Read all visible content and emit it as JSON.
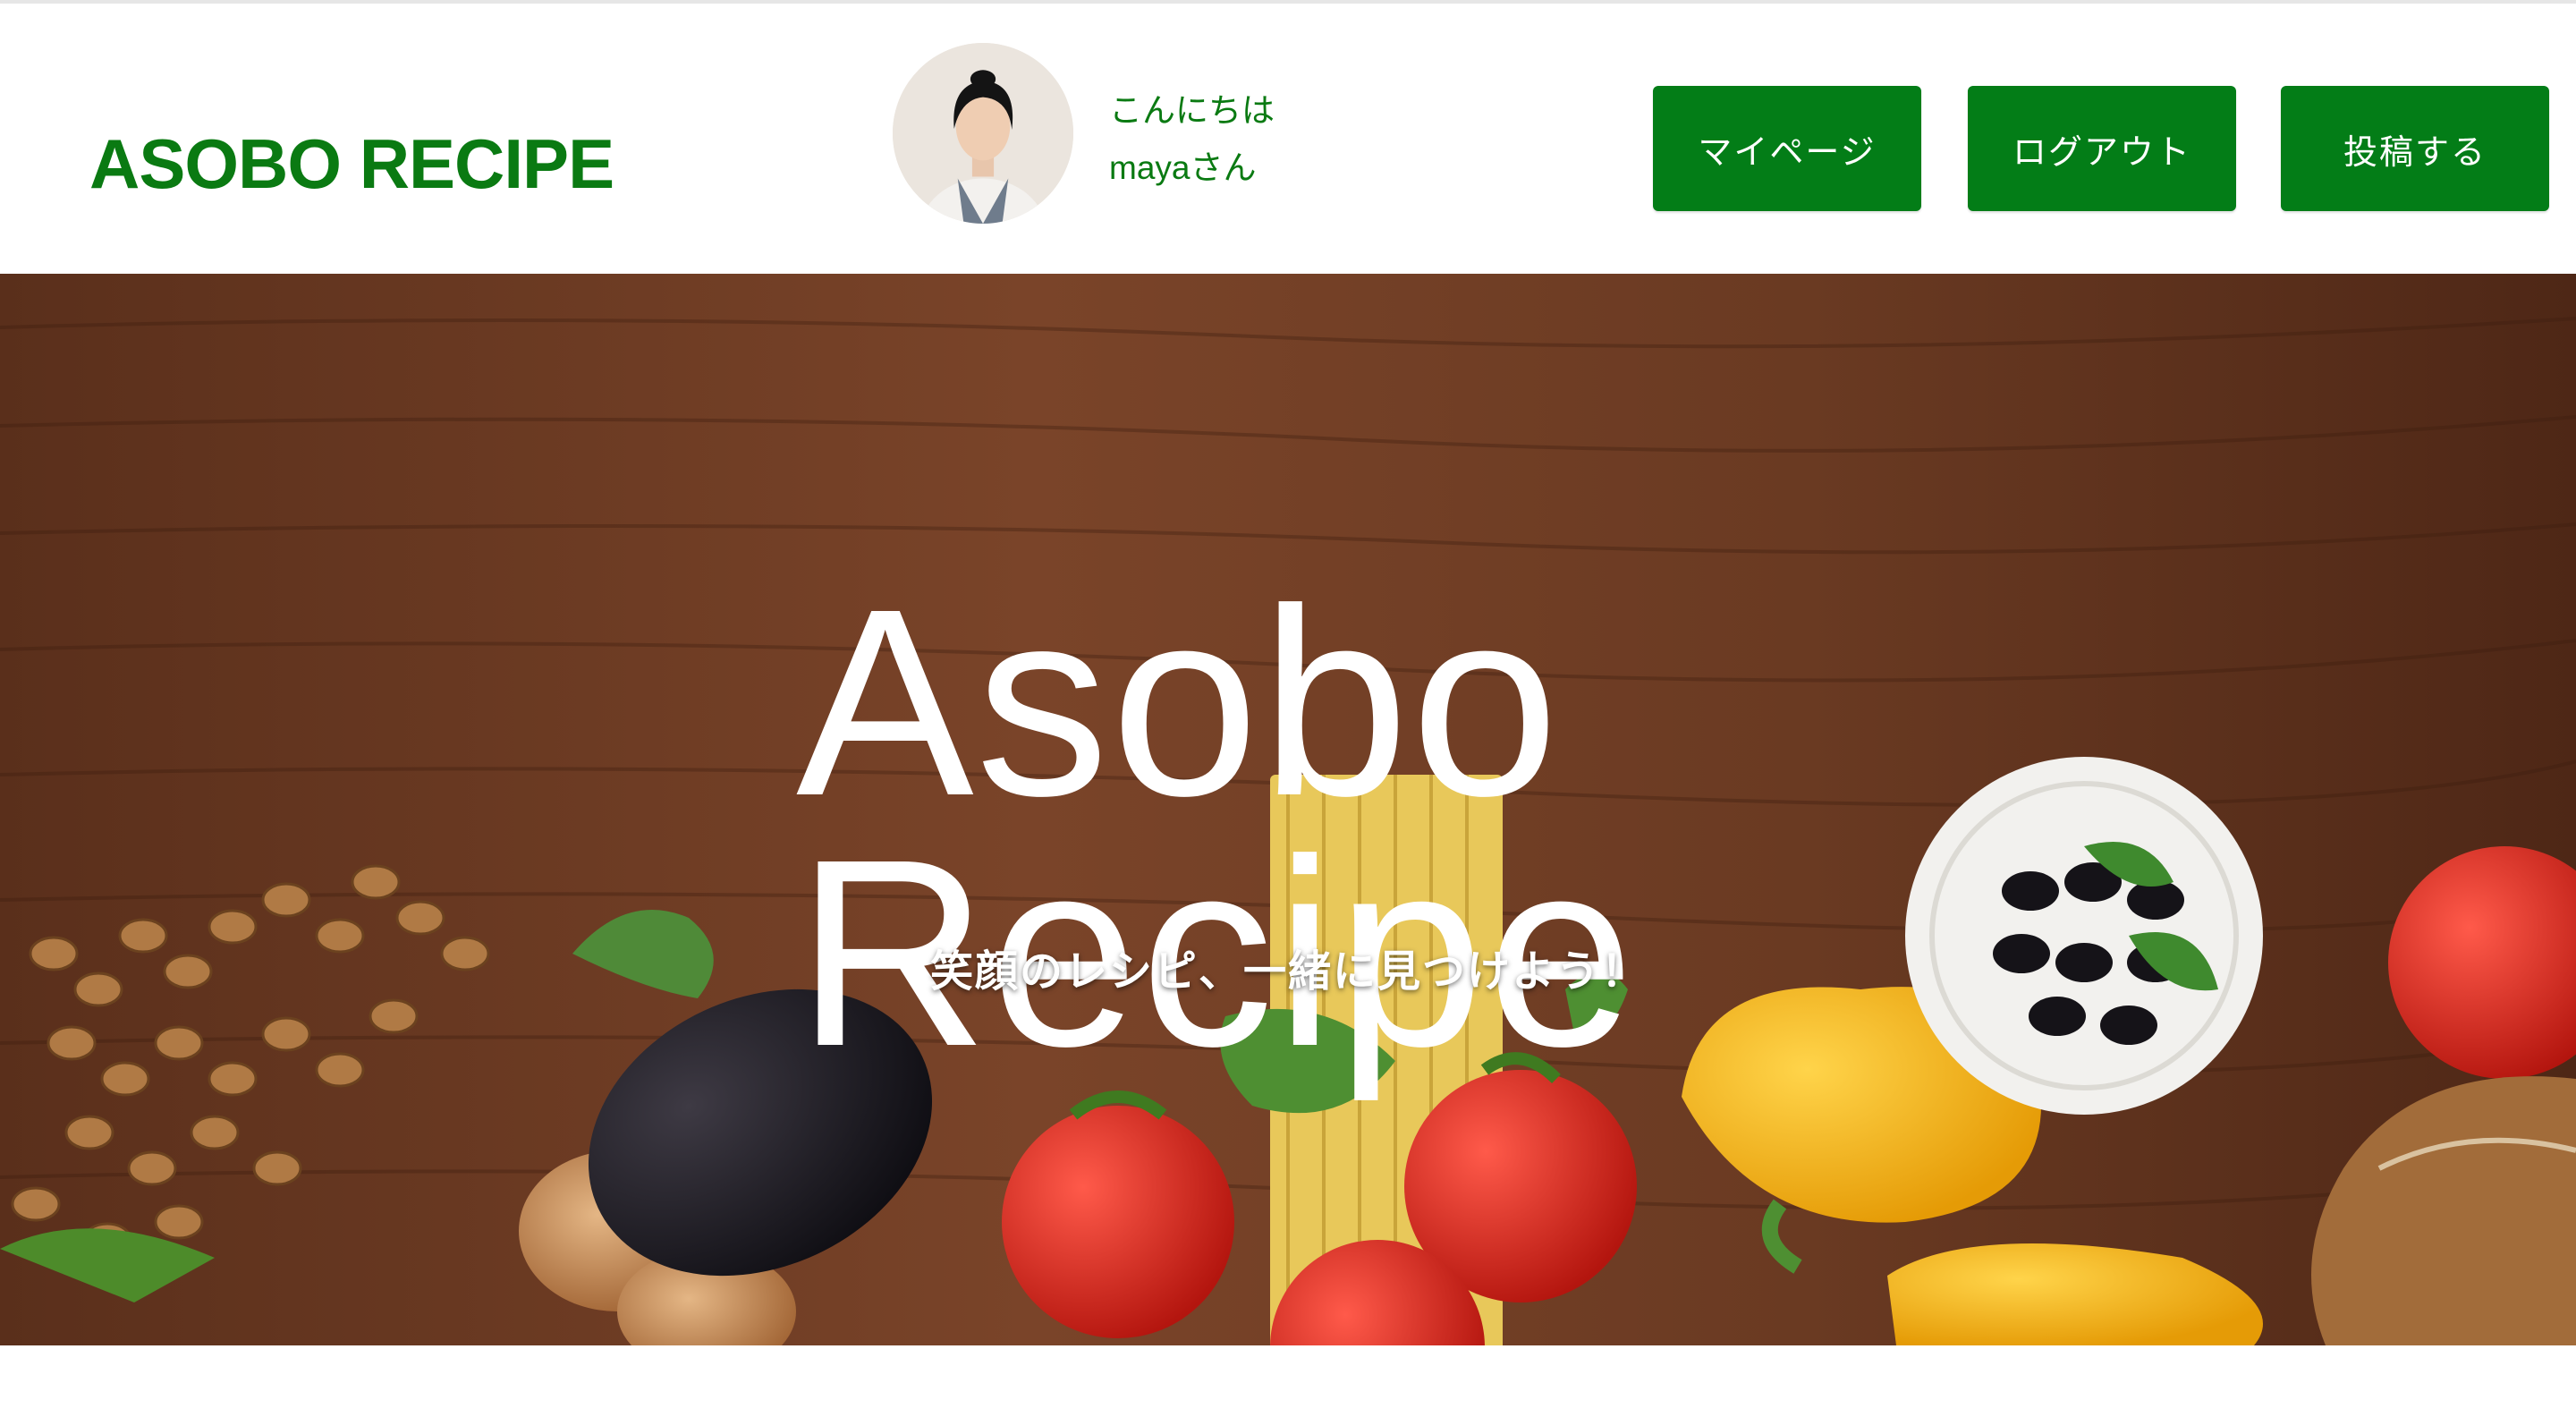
{
  "header": {
    "brand": "ASOBO RECIPE",
    "greeting_line1": "こんにちは",
    "greeting_line2": "mayaさん",
    "buttons": {
      "mypage": "マイページ",
      "logout": "ログアウト",
      "post": "投稿する"
    }
  },
  "hero": {
    "title_line1": "Asobo",
    "title_line2": "Recipe",
    "subtitle": "笑顔のレシピ、一緒に見つけよう！"
  },
  "colors": {
    "brand_green": "#0a7a12",
    "button_green": "#037d17",
    "wood": "#6a3a22"
  }
}
